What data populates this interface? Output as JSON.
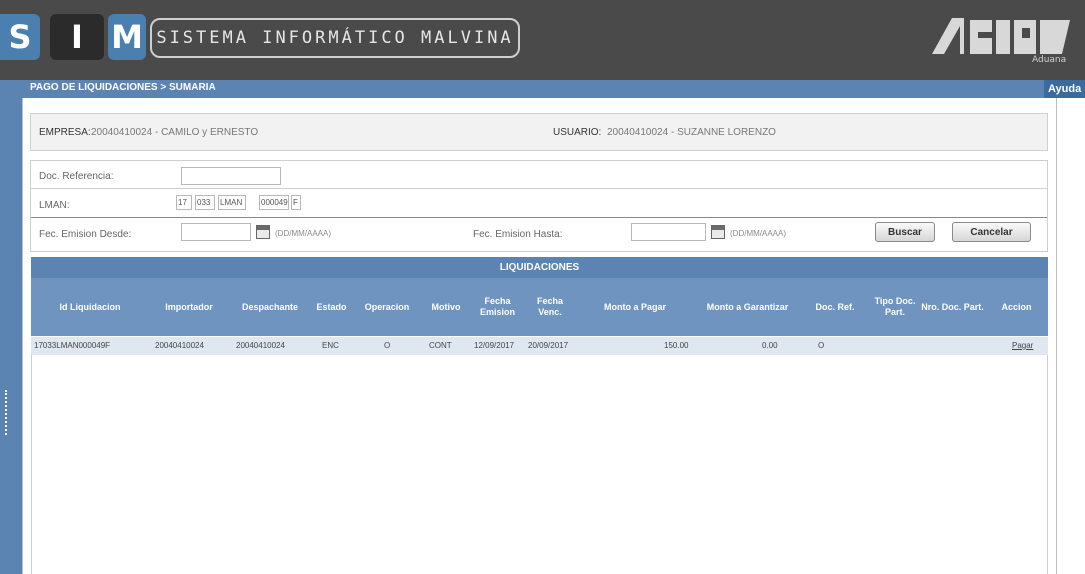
{
  "header": {
    "logo_letters": [
      "S",
      "I",
      "M"
    ],
    "system_name": "SISTEMA INFORMÁTICO MALVINA",
    "agency_logo": "AFIP",
    "agency_sub": "Aduana"
  },
  "nav": {
    "breadcrumb": "PAGO DE LIQUIDACIONES > SUMARIA",
    "help_label": "Ayuda"
  },
  "info": {
    "empresa_label": "EMPRESA:",
    "empresa_value": "20040410024 - CAMILO y ERNESTO",
    "usuario_label": "USUARIO:",
    "usuario_value": "20040410024 - SUZANNE LORENZO"
  },
  "search": {
    "doc_ref_label": "Doc. Referencia:",
    "doc_ref_value": "",
    "lman_label": "LMAN:",
    "lman_fields": [
      "17",
      "033",
      "LMAN",
      "000049",
      "F"
    ],
    "desde_label": "Fec. Emision Desde:",
    "desde_value": "",
    "date_hint": "(DD/MM/AAAA)",
    "hasta_label": "Fec. Emision Hasta:",
    "hasta_value": "",
    "buscar_label": "Buscar",
    "cancelar_label": "Cancelar"
  },
  "table": {
    "title": "LIQUIDACIONES",
    "columns": [
      "Id Liquidacion",
      "Importador",
      "Despachante",
      "Estado",
      "Operacion",
      "Motivo",
      "Fecha Emision",
      "Fecha Venc.",
      "Monto a Pagar",
      "Monto a Garantizar",
      "Doc. Ref.",
      "Tipo Doc. Part.",
      "Nro. Doc. Part.",
      "Accion"
    ],
    "rows": [
      {
        "id": "17033LMAN000049F",
        "importador": "20040410024",
        "despachante": "20040410024",
        "estado": "ENC",
        "operacion": "O",
        "motivo": "CONT",
        "fecha_emision": "12/09/2017",
        "fecha_venc": "20/09/2017",
        "monto_pagar": "150.00",
        "monto_garantizar": "0.00",
        "doc_ref": "O",
        "tipo_doc": "",
        "nro_doc": "",
        "accion": "Pagar"
      }
    ]
  },
  "colors": {
    "header_bg": "#4a4a4a",
    "accent_blue": "#5b84b3",
    "table_header": "#6f94bf",
    "row_bg": "#dfe7f1"
  }
}
